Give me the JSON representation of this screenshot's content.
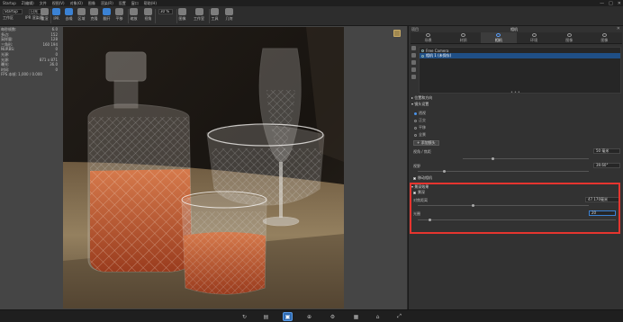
{
  "menu": [
    "Startup",
    "Z(编辑)",
    "文件",
    "视图(V)",
    "对象(O)",
    "图像",
    "渲染(R)",
    "设置",
    "窗口",
    "帮助(H)"
  ],
  "window_controls": [
    "—",
    "□",
    "✕"
  ],
  "toolbar": {
    "preset_input": "Startup",
    "env_input": "日光",
    "value_input": "30 %",
    "buttons": [
      {
        "label": "工作区"
      },
      {
        "label": "IPR 渲染器"
      },
      {
        "label": "重渲"
      },
      {
        "label": "IPR"
      },
      {
        "label": "去噪"
      },
      {
        "label": "区域"
      },
      {
        "label": "克隆"
      },
      {
        "label": "翻开"
      },
      {
        "label": "平移"
      },
      {
        "label": "缩放"
      },
      {
        "label": "视角"
      },
      {
        "label": "图像"
      },
      {
        "label": "工作室"
      },
      {
        "label": "工具"
      },
      {
        "label": "几何"
      }
    ]
  },
  "stats": [
    {
      "k": "每秒帧数:",
      "v": "6.0"
    },
    {
      "k": "多边:",
      "v": "152"
    },
    {
      "k": "采样量:",
      "v": "128"
    },
    {
      "k": "三角形:",
      "v": "160 194"
    },
    {
      "k": "NURBS:",
      "v": "0"
    },
    {
      "k": "光源:",
      "v": "0"
    },
    {
      "k": "光源:",
      "v": "871 x 871"
    },
    {
      "k": "曝光:",
      "v": "36.0"
    },
    {
      "k": "时间:",
      "v": "0"
    },
    {
      "k": "FPS 本帧: 1,000 / 0.000",
      "v": ""
    }
  ],
  "panel": {
    "title": "项目",
    "camera_title": "相机",
    "close": "✕",
    "tabs": [
      {
        "label": "场景",
        "active": false
      },
      {
        "label": "材质",
        "active": false
      },
      {
        "label": "相机",
        "active": true
      },
      {
        "label": "环境",
        "active": false
      },
      {
        "label": "图像",
        "active": false
      },
      {
        "label": "图像",
        "active": false
      }
    ],
    "cameras": [
      {
        "name": "Free Camera",
        "selected": false
      },
      {
        "name": "相机 1 (未保存)",
        "selected": true
      }
    ],
    "splitter": "•••",
    "section_position": "位置和方向",
    "section_lens": "镜头设置",
    "lens_options": [
      {
        "label": "透视",
        "on": true
      },
      {
        "label": "正交",
        "on": false
      },
      {
        "label": "平移",
        "on": false
      },
      {
        "label": "全景",
        "on": false
      }
    ],
    "add_lens_button": "+ 添加镜头",
    "fov_label": "视角 / 焦距",
    "fov_value": "50 毫米",
    "angle_label": "视野",
    "angle_value": "39.60°",
    "shift_label": "移动相机",
    "section_dof": "景深效果",
    "dof_checkbox": "景深",
    "focus_label": "对焦距离",
    "focus_value": "47.170毫米",
    "aperture_label": "光圈",
    "aperture_value": "20"
  },
  "statusbar": {
    "buttons": [
      {
        "icon": "↻",
        "active": false
      },
      {
        "icon": "▤",
        "active": false
      },
      {
        "icon": "▣",
        "active": true
      },
      {
        "icon": "⊕",
        "active": false
      },
      {
        "icon": "⚙",
        "active": false
      },
      {
        "icon": "▦",
        "active": false
      },
      {
        "icon": "⌂",
        "active": false
      },
      {
        "icon": "⤢",
        "active": false
      }
    ]
  },
  "colors": {
    "accent": "#2f6bb3",
    "highlight": "#e6352f",
    "selection": "#1f4f86"
  }
}
